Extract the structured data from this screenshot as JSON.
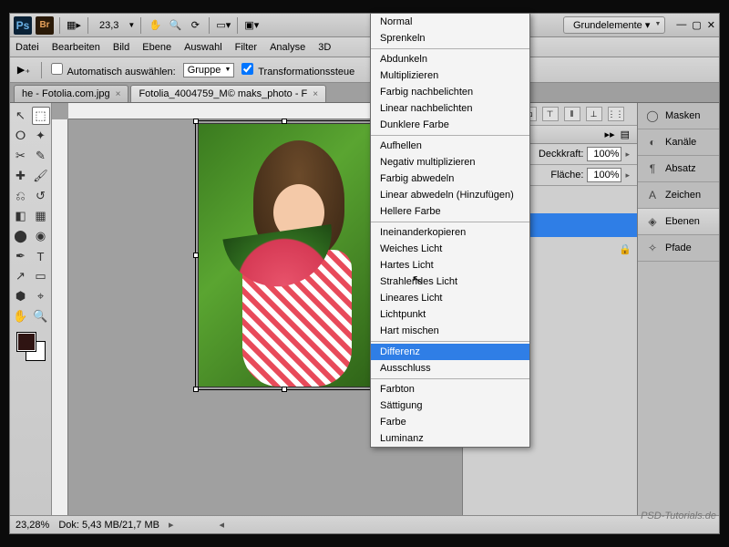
{
  "topbar": {
    "zoom": "23,3",
    "workspace_label": "Grundelemente ▾"
  },
  "menubar": [
    "Datei",
    "Bearbeiten",
    "Bild",
    "Ebene",
    "Auswahl",
    "Filter",
    "Analyse",
    "3D"
  ],
  "options": {
    "auto_select": "Automatisch auswählen:",
    "group": "Gruppe",
    "transform": "Transformationssteue"
  },
  "tabs": [
    {
      "label": "he - Fotolia.com.jpg",
      "active": false
    },
    {
      "label": "Fotolia_4004759_M© maks_photo - F",
      "active": true
    }
  ],
  "panel": {
    "opacity_label": "Deckkraft:",
    "opacity_val": "100%",
    "fill_label": "Fläche:",
    "fill_val": "100%"
  },
  "sidepanels": [
    "Masken",
    "Kanäle",
    "Absatz",
    "Zeichen",
    "Ebenen",
    "Pfade"
  ],
  "status": {
    "zoom": "23,28%",
    "doc": "Dok: 5,43 MB/21,7 MB"
  },
  "blend_groups": [
    [
      "Normal",
      "Sprenkeln"
    ],
    [
      "Abdunkeln",
      "Multiplizieren",
      "Farbig nachbelichten",
      "Linear nachbelichten",
      "Dunklere Farbe"
    ],
    [
      "Aufhellen",
      "Negativ multiplizieren",
      "Farbig abwedeln",
      "Linear abwedeln (Hinzufügen)",
      "Hellere Farbe"
    ],
    [
      "Ineinanderkopieren",
      "Weiches Licht",
      "Hartes Licht",
      "Strahlendes Licht",
      "Lineares Licht",
      "Lichtpunkt",
      "Hart mischen"
    ],
    [
      "Differenz",
      "Ausschluss"
    ],
    [
      "Farbton",
      "Sättigung",
      "Farbe",
      "Luminanz"
    ]
  ],
  "blend_highlight": "Differenz",
  "watermark": "PSD-Tutorials.de"
}
